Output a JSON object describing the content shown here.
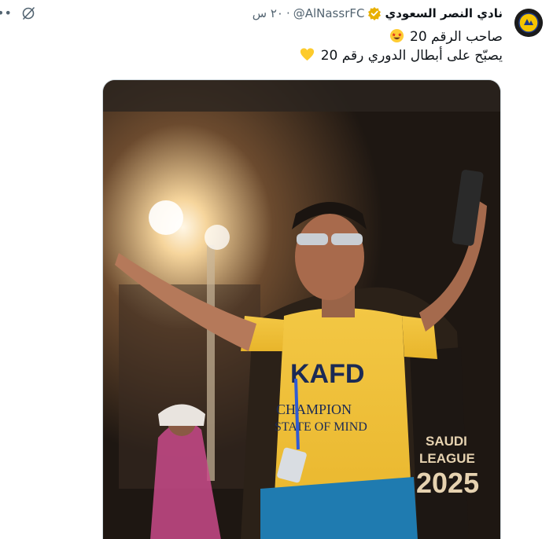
{
  "tweet": {
    "display_name": "نادي النصر السعودي",
    "handle": "@AlNassrFC",
    "separator": "·",
    "time": "٢٠ س",
    "lines": [
      {
        "text": "صاحب الرقم 20",
        "emoji": "star-struck-emoji"
      },
      {
        "text": "يصبّح على أبطال الدوري رقم 20",
        "emoji": "yellow-heart-emoji"
      }
    ],
    "media": {
      "kit_text": [
        "KAFD",
        "CHAMPION",
        "STATE OF MIND"
      ],
      "banner_text": [
        "SAUDI",
        "LEAGUE",
        "2025"
      ]
    }
  },
  "colors": {
    "accent_gold": "#f5b800",
    "verified_gold": "#e8b000",
    "secondary_text": "#536471"
  }
}
